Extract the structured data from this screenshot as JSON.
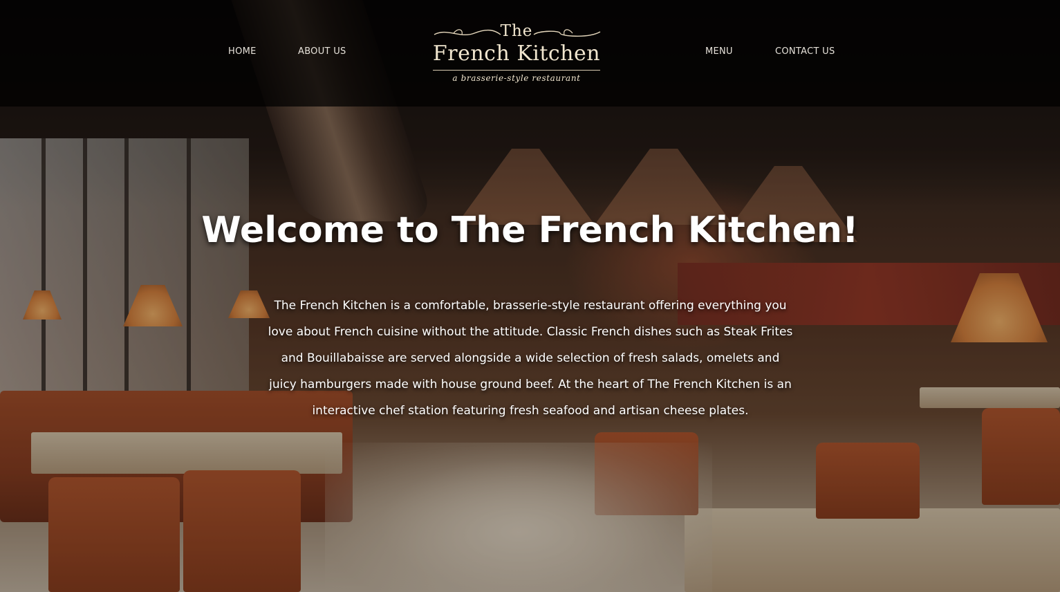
{
  "nav": {
    "left": [
      {
        "label": "HOME"
      },
      {
        "label": "ABOUT US"
      }
    ],
    "right": [
      {
        "label": "MENU"
      },
      {
        "label": "CONTACT US"
      }
    ]
  },
  "logo": {
    "the": "The",
    "name": "French Kitchen",
    "tagline": "a brasserie-style restaurant"
  },
  "hero": {
    "title": "Welcome to The French Kitchen!",
    "body": "The French Kitchen is a comfortable, brasserie-style restaurant offering everything you love about French cuisine without the attitude. Classic French dishes such as Steak Frites and Bouillabaisse are served alongside a wide selection of fresh salads, omelets and juicy hamburgers made with house ground beef. At the heart of The French Kitchen is an interactive chef station featuring fresh seafood and artisan cheese plates."
  },
  "colors": {
    "header_bg": "#000000",
    "logo_text": "#f1e6cf",
    "nav_text": "#e7e2da",
    "hero_text": "#ffffff"
  }
}
